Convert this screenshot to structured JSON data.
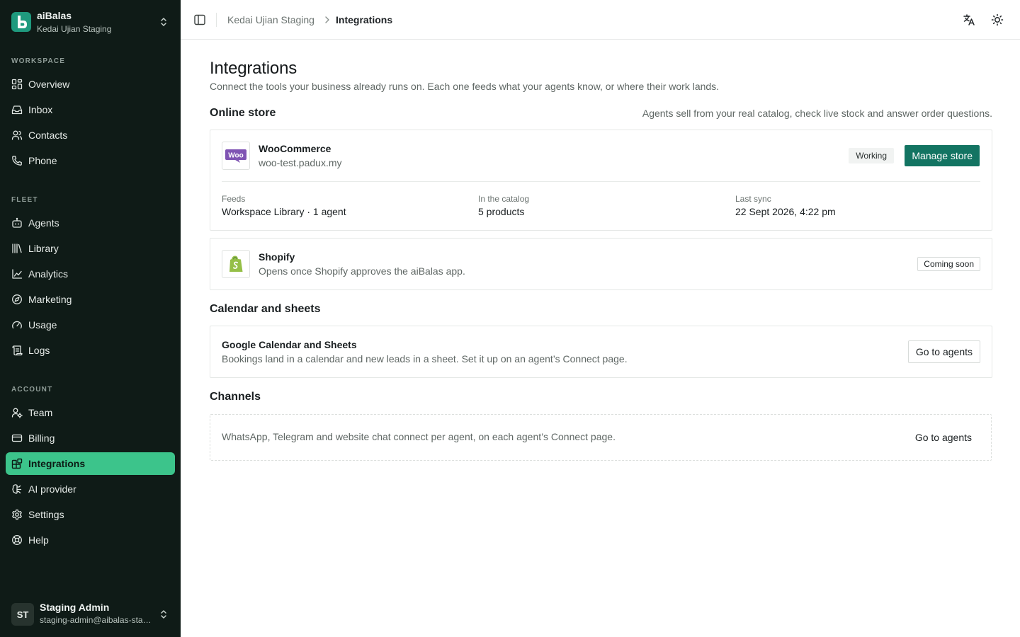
{
  "workspace": {
    "name": "aiBalas",
    "subtitle": "Kedai Ujian Staging"
  },
  "sidebar": {
    "sections": [
      {
        "label": "WORKSPACE",
        "items": [
          "Overview",
          "Inbox",
          "Contacts",
          "Phone"
        ]
      },
      {
        "label": "FLEET",
        "items": [
          "Agents",
          "Library",
          "Analytics",
          "Marketing",
          "Usage",
          "Logs"
        ]
      },
      {
        "label": "ACCOUNT",
        "items": [
          "Team",
          "Billing",
          "Integrations",
          "AI provider",
          "Settings",
          "Help"
        ]
      }
    ],
    "active": "Integrations"
  },
  "user": {
    "initials": "ST",
    "name": "Staging Admin",
    "email": "staging-admin@aibalas-staging.com"
  },
  "breadcrumb": {
    "parent": "Kedai Ujian Staging",
    "current": "Integrations"
  },
  "page": {
    "title": "Integrations",
    "subtitle": "Connect the tools your business already runs on. Each one feeds what your agents know, or where their work lands."
  },
  "online_store": {
    "title": "Online store",
    "note": "Agents sell from your real catalog, check live stock and answer order questions.",
    "woocommerce": {
      "logo_text": "Woo",
      "name": "WooCommerce",
      "domain": "woo-test.padux.my",
      "status": "Working",
      "action": "Manage store",
      "stats": [
        {
          "label": "Feeds",
          "value": "Workspace Library · 1 agent"
        },
        {
          "label": "In the catalog",
          "value": "5 products"
        },
        {
          "label": "Last sync",
          "value": "22 Sept 2026, 4:22 pm"
        }
      ]
    },
    "shopify": {
      "name": "Shopify",
      "desc": "Opens once Shopify approves the aiBalas app.",
      "status": "Coming soon"
    }
  },
  "calendar": {
    "title": "Calendar and sheets",
    "name": "Google Calendar and Sheets",
    "desc": "Bookings land in a calendar and new leads in a sheet. Set it up on an agent’s Connect page.",
    "action": "Go to agents"
  },
  "channels": {
    "title": "Channels",
    "desc": "WhatsApp, Telegram and website chat connect per agent, on each agent’s Connect page.",
    "action": "Go to agents"
  },
  "colors": {
    "sidebar_bg": "#0f1b17",
    "active_nav": "#3cc48b",
    "primary_button": "#137462",
    "woo_purple": "#7f54b3",
    "shopify_green": "#95bf47"
  }
}
